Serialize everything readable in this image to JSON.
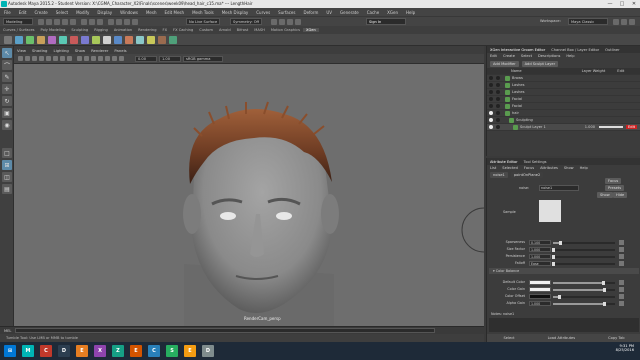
{
  "window": {
    "title": "Autodesk Maya 2015.2 - Student Version: X:\\CGMA_Character_X2\\Finals\\scenes\\week09\\head_hair_c15.ma*  ---  LengthHair",
    "minimize": "—",
    "maximize": "□",
    "close": "✕"
  },
  "menubar": [
    "File",
    "Edit",
    "Create",
    "Select",
    "Modify",
    "Display",
    "Windows",
    "Mesh",
    "Edit Mesh",
    "Mesh Tools",
    "Mesh Display",
    "Curves",
    "Surfaces",
    "Deform",
    "UV",
    "Generate",
    "Cache",
    "XGen",
    "Help"
  ],
  "workspace_label": "Workspace:",
  "workspace_value": "Maya Classic",
  "mode_dropdown": "Modeling",
  "live_surface": "No Live Surface",
  "symmetry": "Symmetry: Off",
  "sign_in": "Sign In",
  "shelf_tabs": [
    "Curves / Surfaces",
    "Poly Modeling",
    "Sculpting",
    "Rigging",
    "Animation",
    "Rendering",
    "FX",
    "FX Caching",
    "Custom",
    "Arnold",
    "Bifrost",
    "MASH",
    "Motion Graphics",
    "XGen"
  ],
  "shelf_active": "XGen",
  "toolbox": [
    "select-icon",
    "lasso-icon",
    "paint-icon",
    "move-icon",
    "rotate-icon",
    "scale-icon",
    "last-tool-icon",
    "layout-single-icon",
    "layout-four-icon",
    "layout-side-icon",
    "layout-persp-icon"
  ],
  "viewport": {
    "menu": [
      "View",
      "Shading",
      "Lighting",
      "Show",
      "Renderer",
      "Panels"
    ],
    "camera_label": "RenderCam_persp",
    "gamma": "sRGB gamma",
    "value1": "0.00",
    "value2": "1.00"
  },
  "command_line": {
    "label": "MEL"
  },
  "help_line": "Tumble Tool: Use LMB or MMB to tumble",
  "xgen": {
    "title": "XGen Interactive Groom Editor",
    "tabs": [
      "XGen Interactive Groom Editor",
      "Channel Box / Layer Editor",
      "Outliner"
    ],
    "menu": [
      "Edit",
      "Create",
      "Select",
      "Descriptions",
      "Help"
    ],
    "add_modifier": "Add Modifier",
    "add_sculpt": "Add Sculpt Layer",
    "col_name": "Name",
    "col_weight": "Layer Weight",
    "col_edit": "Edit",
    "rows": [
      {
        "name": "Brows",
        "vis": false
      },
      {
        "name": "Lashes",
        "vis": false
      },
      {
        "name": "Lashes",
        "vis": false
      },
      {
        "name": "Facial",
        "vis": false
      },
      {
        "name": "Facial",
        "vis": false
      },
      {
        "name": "hair",
        "vis": true
      },
      {
        "name": "Sculpting",
        "vis": true
      },
      {
        "name": "Sculpt Layer 1",
        "vis": true,
        "weight": "1.000",
        "edit": "Edit"
      }
    ]
  },
  "attr": {
    "tabs": [
      "Attribute Editor",
      "Tool Settings"
    ],
    "menu": [
      "List",
      "Selected",
      "Focus",
      "Attributes",
      "Show",
      "Help"
    ],
    "node_tab": "noise1",
    "node_tab2": "pointOnPlane2",
    "type_label": "noise1",
    "name_label": "noise:",
    "name_value": "noise1",
    "focus": "Focus",
    "presets": "Presets",
    "show": "Show",
    "hide": "Hide",
    "sample_label": "Sample",
    "fields": [
      {
        "label": "Sparseness",
        "value": "0.100",
        "pct": 0.12
      },
      {
        "label": "Size Factor",
        "value": "1.000",
        "pct": 0.0
      },
      {
        "label": "Persistence",
        "value": "1.000",
        "pct": 0.0
      },
      {
        "label": "Falloff",
        "value": "Ease",
        "pct": 0
      },
      {
        "label": "Color Balance",
        "value": "",
        "pct": 0
      }
    ],
    "section": "Color Balance",
    "color_fields": [
      {
        "label": "Default Color",
        "value": "",
        "pct": 0.8
      },
      {
        "label": "Color Gain",
        "value": "",
        "pct": 0.82
      },
      {
        "label": "Color Offset",
        "value": "",
        "pct": 0.1
      },
      {
        "label": "Alpha Gain",
        "value": "1.000",
        "pct": 0.82
      }
    ],
    "notes_label": "Notes: noise1",
    "btn_select": "Select",
    "btn_load": "Load Attributes",
    "btn_copy": "Copy Tab"
  },
  "taskbar": {
    "apps": [
      "M",
      "C",
      "D",
      "E",
      "X",
      "Z",
      "E",
      "C",
      "S",
      "E",
      "D"
    ],
    "time": "9:31 PM",
    "date": "8/25/2016"
  },
  "colors": {
    "maya_teal": "#00b5b5",
    "accent_red": "#cc2222",
    "vp_bg": "#6e6e6e"
  }
}
